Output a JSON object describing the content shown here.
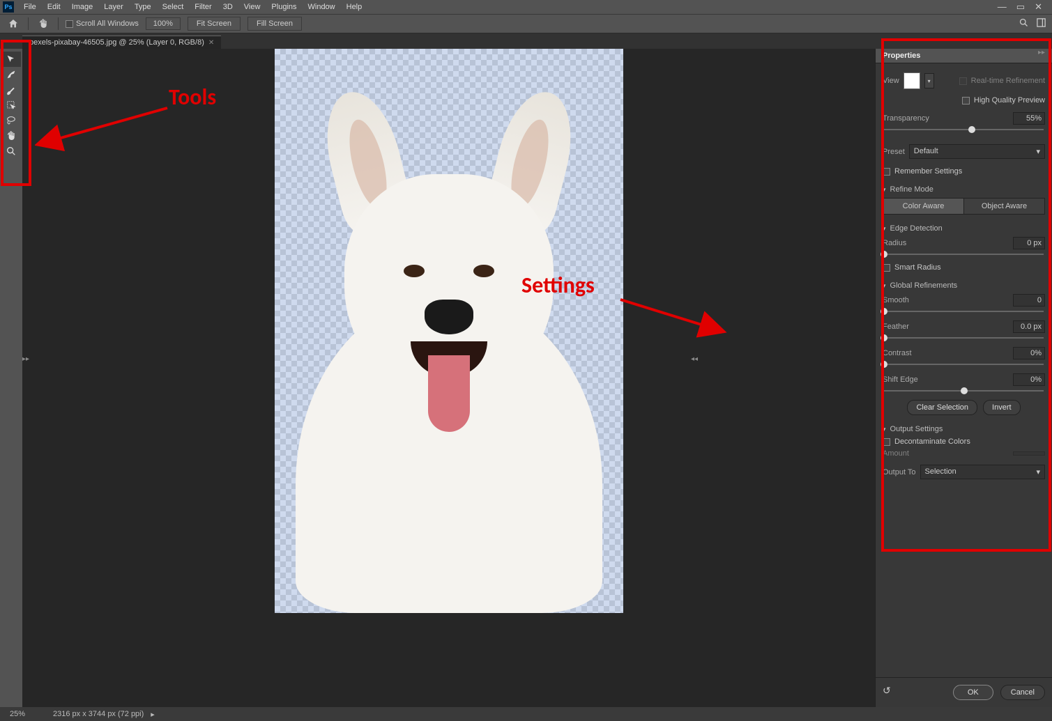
{
  "menu": [
    "File",
    "Edit",
    "Image",
    "Layer",
    "Type",
    "Select",
    "Filter",
    "3D",
    "View",
    "Plugins",
    "Window",
    "Help"
  ],
  "optbar": {
    "scroll_all": "Scroll All Windows",
    "zoom": "100%",
    "fit": "Fit Screen",
    "fill": "Fill Screen"
  },
  "doc_tab": "pexels-pixabay-46505.jpg @ 25% (Layer 0, RGB/8)",
  "annotations": {
    "tools": "Tools",
    "settings": "Settings"
  },
  "panel": {
    "title": "Properties",
    "view": "View",
    "realtime": "Real-time Refinement",
    "hq": "High Quality Preview",
    "transparency": {
      "label": "Transparency",
      "value": "55%",
      "pct": 55
    },
    "preset": {
      "label": "Preset",
      "value": "Default"
    },
    "remember": "Remember Settings",
    "refine_mode": {
      "label": "Refine Mode",
      "color_aware": "Color Aware",
      "object_aware": "Object Aware"
    },
    "edge_detection": {
      "label": "Edge Detection",
      "radius": {
        "label": "Radius",
        "value": "0 px",
        "pct": 0
      },
      "smart": "Smart Radius"
    },
    "global": {
      "label": "Global Refinements",
      "smooth": {
        "label": "Smooth",
        "value": "0",
        "pct": 0
      },
      "feather": {
        "label": "Feather",
        "value": "0.0 px",
        "pct": 0
      },
      "contrast": {
        "label": "Contrast",
        "value": "0%",
        "pct": 0
      },
      "shift": {
        "label": "Shift Edge",
        "value": "0%",
        "pct": 50
      },
      "clear": "Clear Selection",
      "invert": "Invert"
    },
    "output": {
      "label": "Output Settings",
      "decon": "Decontaminate Colors",
      "amount": "Amount",
      "output_to": "Output To",
      "output_val": "Selection"
    },
    "ok": "OK",
    "cancel": "Cancel"
  },
  "status": {
    "zoom": "25%",
    "dims": "2316 px x 3744 px (72 ppi)"
  }
}
